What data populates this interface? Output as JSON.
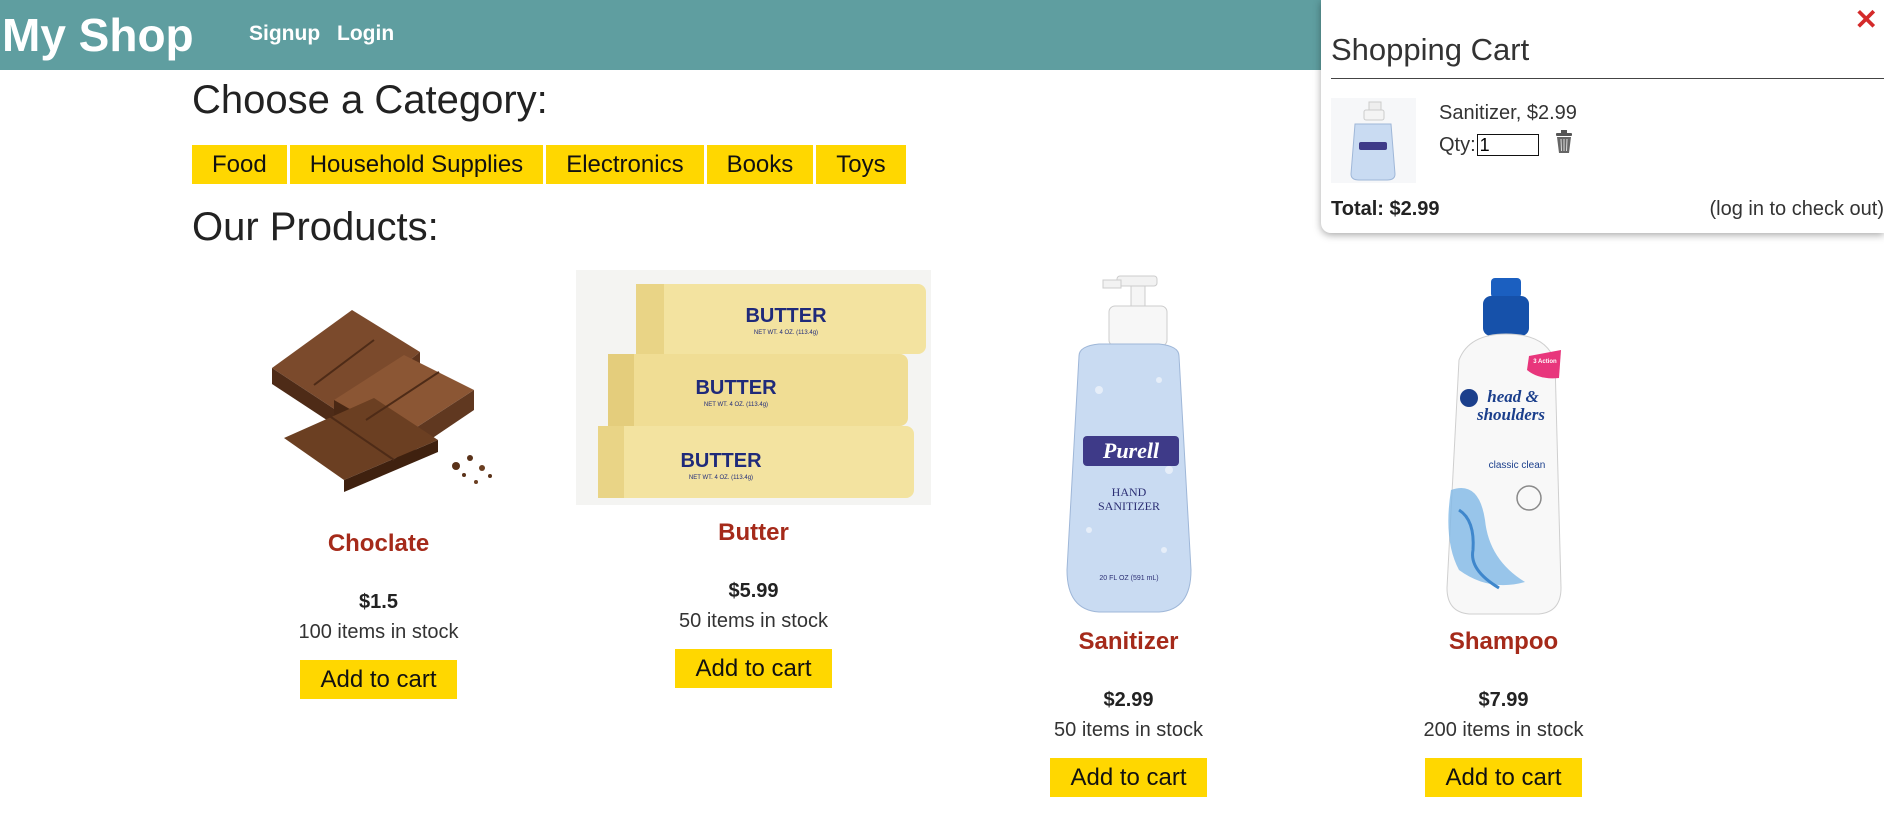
{
  "navbar": {
    "brand": "My Shop",
    "signup": "Signup",
    "login": "Login"
  },
  "categories": {
    "heading": "Choose a Category:",
    "items": [
      "Food",
      "Household Supplies",
      "Electronics",
      "Books",
      "Toys"
    ]
  },
  "products": {
    "heading": "Our Products:",
    "items": [
      {
        "name": "Choclate",
        "price": "$1.5",
        "stock": "100 items in stock",
        "button": "Add to cart"
      },
      {
        "name": "Butter",
        "price": "$5.99",
        "stock": "50 items in stock",
        "button": "Add to cart"
      },
      {
        "name": "Sanitizer",
        "price": "$2.99",
        "stock": "50 items in stock",
        "button": "Add to cart"
      },
      {
        "name": "Shampoo",
        "price": "$7.99",
        "stock": "200 items in stock",
        "button": "Add to cart"
      }
    ]
  },
  "butter_labels": {
    "main": "BUTTER",
    "sub": "NET WT. 4 OZ. (113.4g)"
  },
  "sanitizer_label": {
    "brand": "Purell",
    "line1": "HAND",
    "line2": "SANITIZER",
    "size": "20 FL OZ (591 mL)"
  },
  "shampoo_label": {
    "brand1": "head &",
    "brand2": "shoulders",
    "variant": "classic clean",
    "badge": "3 Action"
  },
  "cart": {
    "title": "Shopping Cart",
    "item_text": "Sanitizer, $2.99",
    "qty_label": "Qty:",
    "qty_value": "1",
    "total": "Total: $2.99",
    "login_note": "(log in to check out)"
  },
  "colors": {
    "navbar": "#5f9ea0",
    "accent_yellow": "#ffd700",
    "product_name": "#a52a1a",
    "close": "#d42a2a"
  },
  "icons": [
    "close-icon",
    "trash-icon"
  ]
}
